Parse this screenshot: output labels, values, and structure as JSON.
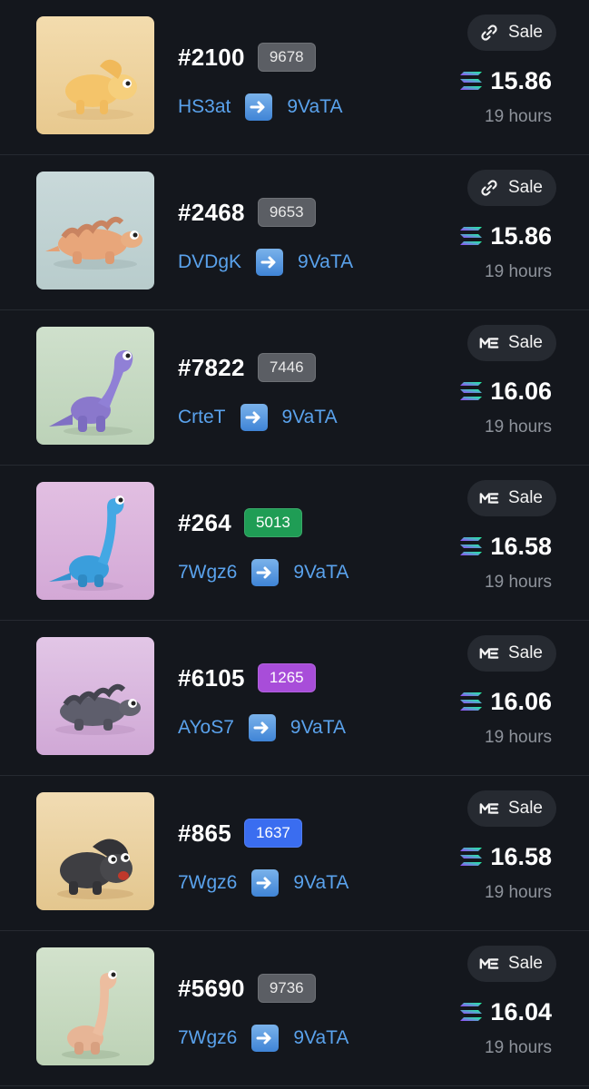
{
  "items": [
    {
      "id": "#2100",
      "rank": "9678",
      "rank_color": "gray",
      "from": "HS3at",
      "to": "9VaTA",
      "market": "link-icon",
      "label": "Sale",
      "price": "15.86",
      "time": "19 hours",
      "bg": [
        "#f3dcae",
        "#e8c98f"
      ],
      "dino": "trike-yellow"
    },
    {
      "id": "#2468",
      "rank": "9653",
      "rank_color": "gray",
      "from": "DVDgK",
      "to": "9VaTA",
      "market": "link-icon",
      "label": "Sale",
      "price": "15.86",
      "time": "19 hours",
      "bg": [
        "#c9d9da",
        "#b8cccc"
      ],
      "dino": "anky-orange"
    },
    {
      "id": "#7822",
      "rank": "7446",
      "rank_color": "gray",
      "from": "CrteT",
      "to": "9VaTA",
      "market": "magic-eden-icon",
      "label": "Sale",
      "price": "16.06",
      "time": "19 hours",
      "bg": [
        "#cfe0cc",
        "#bcd2b8"
      ],
      "dino": "bronto-purple"
    },
    {
      "id": "#264",
      "rank": "5013",
      "rank_color": "green",
      "from": "7Wgz6",
      "to": "9VaTA",
      "market": "magic-eden-icon",
      "label": "Sale",
      "price": "16.58",
      "time": "19 hours",
      "bg": [
        "#e2bfe2",
        "#d3a8d6"
      ],
      "dino": "bronto-blue"
    },
    {
      "id": "#6105",
      "rank": "1265",
      "rank_color": "purple",
      "from": "AYoS7",
      "to": "9VaTA",
      "market": "magic-eden-icon",
      "label": "Sale",
      "price": "16.06",
      "time": "19 hours",
      "bg": [
        "#e2c6e6",
        "#d0a8d6"
      ],
      "dino": "anky-gray"
    },
    {
      "id": "#865",
      "rank": "1637",
      "rank_color": "blue",
      "from": "7Wgz6",
      "to": "9VaTA",
      "market": "magic-eden-icon",
      "label": "Sale",
      "price": "16.58",
      "time": "19 hours",
      "bg": [
        "#f1dcb3",
        "#e3c68e"
      ],
      "dino": "trike-dark"
    },
    {
      "id": "#5690",
      "rank": "9736",
      "rank_color": "gray",
      "from": "7Wgz6",
      "to": "9VaTA",
      "market": "magic-eden-icon",
      "label": "Sale",
      "price": "16.04",
      "time": "19 hours",
      "bg": [
        "#d2e2cc",
        "#bdd2b6"
      ],
      "dino": "bronto-tan"
    }
  ]
}
